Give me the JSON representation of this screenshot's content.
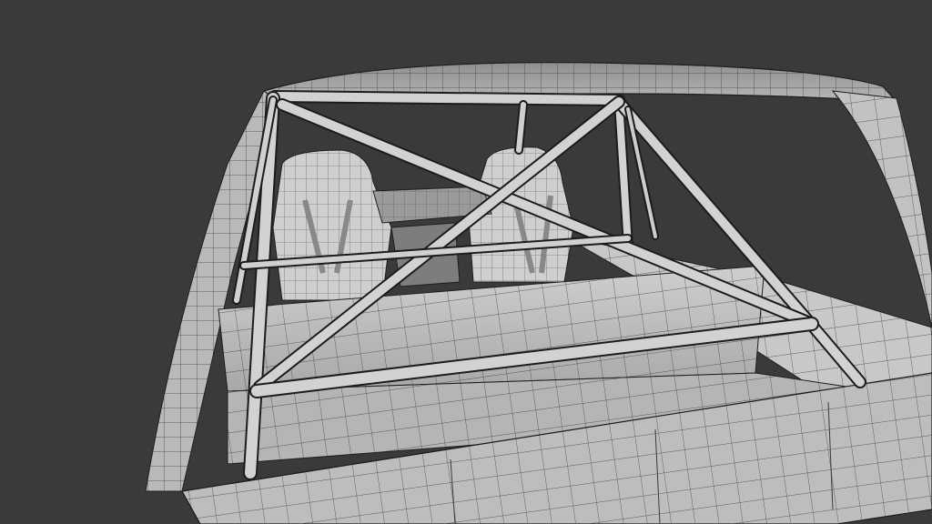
{
  "viewport": {
    "background": "#3a3a3a",
    "subject": "roll-cage-car-interior-wireframe",
    "shading": "solid",
    "overlay": "wireframe"
  },
  "colors": {
    "surface_light": "#c9c9c9",
    "surface_mid": "#a9a9a9",
    "surface_dark": "#8a8a8a",
    "wire": "#2b2b2b",
    "tube_fill": "#d2d2d2",
    "tube_edge": "#1c1c1c"
  }
}
